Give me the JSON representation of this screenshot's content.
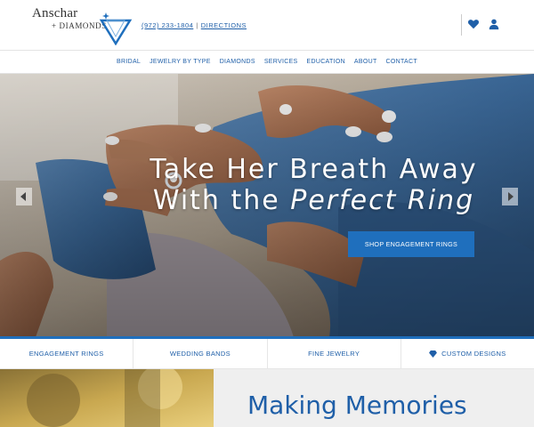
{
  "header": {
    "logo_main": "Anschar",
    "logo_sub": "+ DIAMONDS",
    "phone": "(972) 233-1804",
    "directions": "DIRECTIONS",
    "separator": "|",
    "icons": [
      "heart-icon",
      "user-icon"
    ]
  },
  "nav": {
    "items": [
      {
        "label": "BRIDAL"
      },
      {
        "label": "JEWELRY BY TYPE"
      },
      {
        "label": "DIAMONDS"
      },
      {
        "label": "SERVICES"
      },
      {
        "label": "EDUCATION"
      },
      {
        "label": "ABOUT"
      },
      {
        "label": "CONTACT"
      }
    ]
  },
  "hero": {
    "title_line1": "Take Her Breath Away",
    "title_line2_prefix": "With the ",
    "title_line2_emph": "Perfect Ring",
    "cta": "SHOP ENGAGEMENT RINGS",
    "prev_icon": "chevron-left-icon",
    "next_icon": "chevron-right-icon"
  },
  "categories": [
    {
      "label": "ENGAGEMENT RINGS"
    },
    {
      "label": "WEDDING BANDS"
    },
    {
      "label": "FINE JEWELRY"
    },
    {
      "label": "CUSTOM DESIGNS",
      "icon": "diamond-icon"
    }
  ],
  "bottom": {
    "title": "Making Memories"
  },
  "colors": {
    "brand_blue": "#1f5fa8",
    "button_blue": "#1f6fbd",
    "denim": "#3a6b9c",
    "panel_gray": "#efefef"
  }
}
